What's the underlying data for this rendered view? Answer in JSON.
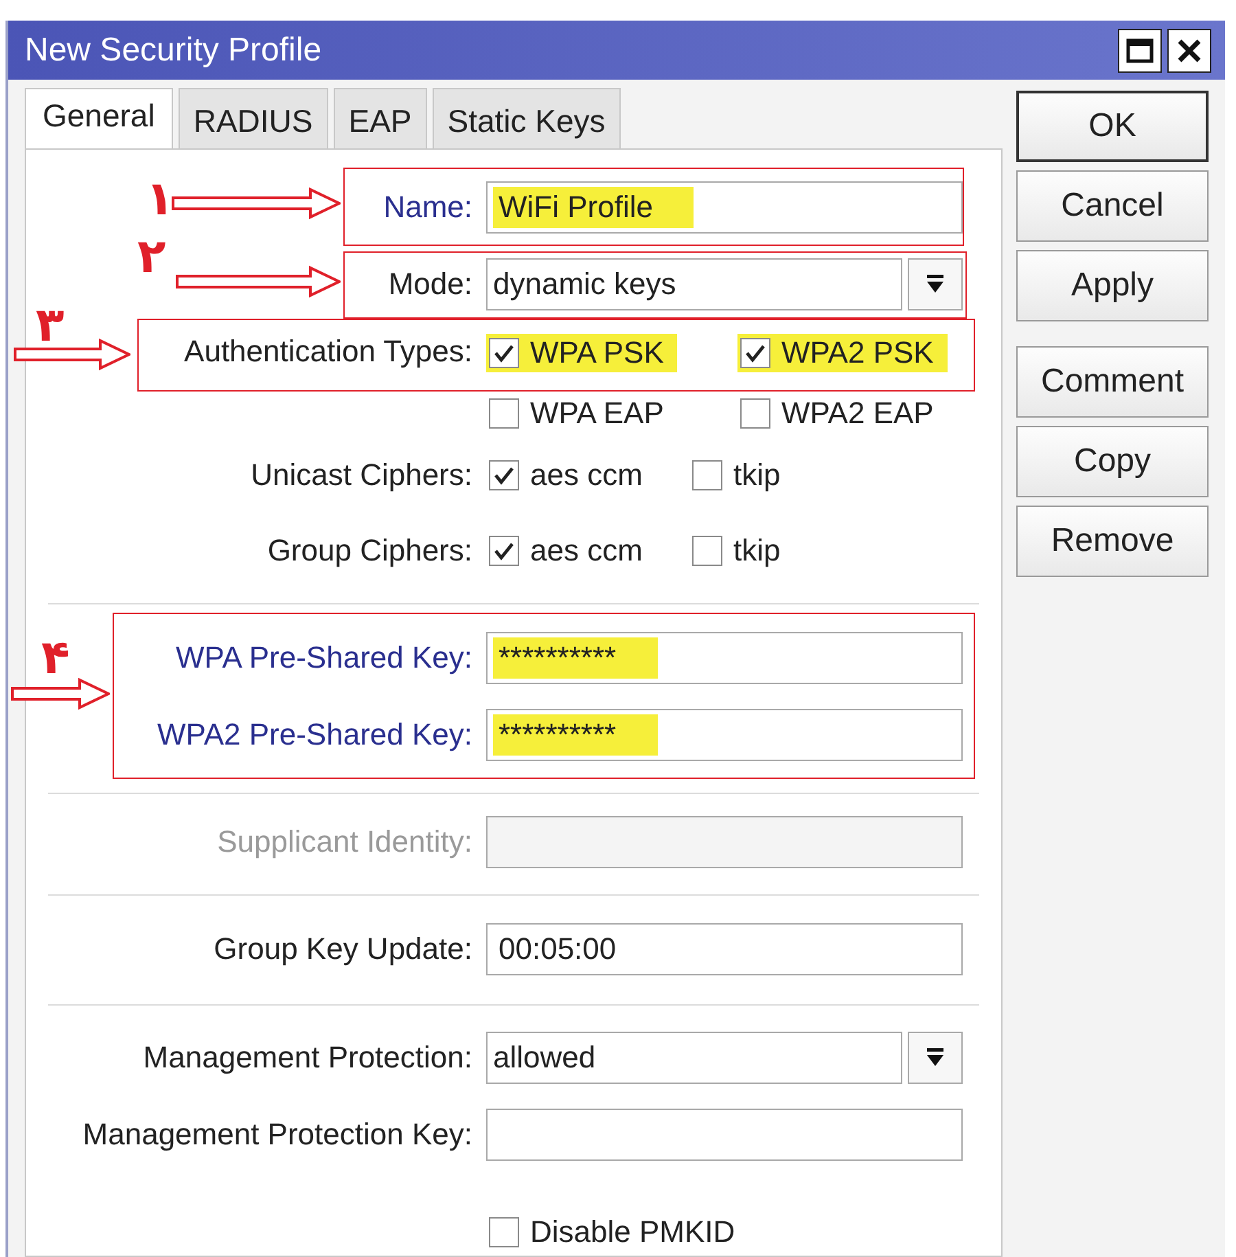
{
  "window": {
    "title": "New Security Profile"
  },
  "tabs": [
    {
      "label": "General",
      "selected": true
    },
    {
      "label": "RADIUS",
      "selected": false
    },
    {
      "label": "EAP",
      "selected": false
    },
    {
      "label": "Static Keys",
      "selected": false
    }
  ],
  "form": [
    {
      "kind": "text",
      "label": "Name:",
      "emphasized": true,
      "value": "WiFi Profile",
      "highlighted": true
    },
    {
      "kind": "select",
      "label": "Mode:",
      "emphasized": false,
      "value": "dynamic keys"
    },
    {
      "kind": "checks",
      "label": "Authentication Types:",
      "emphasized": false,
      "options": [
        {
          "label": "WPA PSK",
          "checked": true,
          "highlighted": true
        },
        {
          "label": "WPA2 PSK",
          "checked": true,
          "highlighted": true
        },
        {
          "label": "WPA EAP",
          "checked": false,
          "highlighted": false
        },
        {
          "label": "WPA2 EAP",
          "checked": false,
          "highlighted": false
        }
      ]
    },
    {
      "kind": "checks",
      "label": "Unicast Ciphers:",
      "emphasized": false,
      "options": [
        {
          "label": "aes ccm",
          "checked": true,
          "highlighted": false
        },
        {
          "label": "tkip",
          "checked": false,
          "highlighted": false
        }
      ]
    },
    {
      "kind": "checks",
      "label": "Group Ciphers:",
      "emphasized": false,
      "options": [
        {
          "label": "aes ccm",
          "checked": true,
          "highlighted": false
        },
        {
          "label": "tkip",
          "checked": false,
          "highlighted": false
        }
      ]
    },
    {
      "kind": "divider"
    },
    {
      "kind": "text",
      "label": "WPA Pre-Shared Key:",
      "emphasized": true,
      "value": "**********",
      "highlighted": true
    },
    {
      "kind": "text",
      "label": "WPA2 Pre-Shared Key:",
      "emphasized": true,
      "value": "**********",
      "highlighted": true
    },
    {
      "kind": "divider"
    },
    {
      "kind": "text",
      "label": "Supplicant Identity:",
      "disabled": true
    },
    {
      "kind": "divider"
    },
    {
      "kind": "text",
      "label": "Group Key Update:",
      "emphasized": false,
      "value": "00:05:00"
    },
    {
      "kind": "divider"
    },
    {
      "kind": "select",
      "label": "Management Protection:",
      "emphasized": false,
      "value": "allowed"
    },
    {
      "kind": "text",
      "label": "Management Protection Key:",
      "emphasized": false
    },
    {
      "kind": "check",
      "label": "Disable PMKID",
      "checked": false
    }
  ],
  "buttons": [
    {
      "label": "OK",
      "default": true
    },
    {
      "label": "Cancel",
      "default": false
    },
    {
      "label": "Apply",
      "default": false
    },
    {
      "label": "Comment",
      "default": false
    },
    {
      "label": "Copy",
      "default": false
    },
    {
      "label": "Remove",
      "default": false
    }
  ],
  "annotations": [
    {
      "number": "۱"
    },
    {
      "number": "۲"
    },
    {
      "number": "۳"
    },
    {
      "number": "۴"
    }
  ]
}
